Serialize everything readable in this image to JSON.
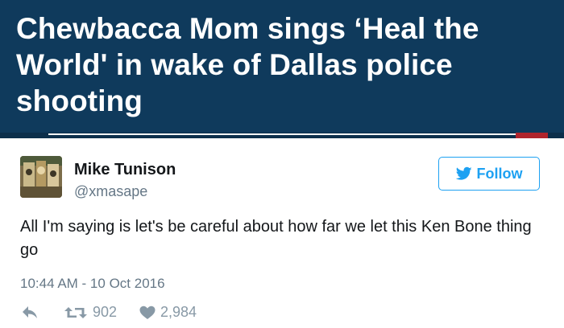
{
  "headline": {
    "text": "Chewbacca Mom sings ‘Heal the World' in wake of Dallas police shooting"
  },
  "tweet": {
    "user_name": "Mike Tunison",
    "user_handle": "@xmasape",
    "follow_label": "Follow",
    "text": "All I'm saying is let's be careful about how far we let this Ken Bone thing go",
    "timestamp": "10:44 AM - 10 Oct 2016",
    "retweets": "902",
    "likes": "2,984"
  },
  "colors": {
    "headline_bg": "#0f3a5c",
    "twitter_blue": "#1da1f2",
    "muted_text": "#657786",
    "action_gray": "#8899a6"
  },
  "icons": [
    "twitter-bird-icon",
    "reply-icon",
    "retweet-icon",
    "heart-icon"
  ]
}
